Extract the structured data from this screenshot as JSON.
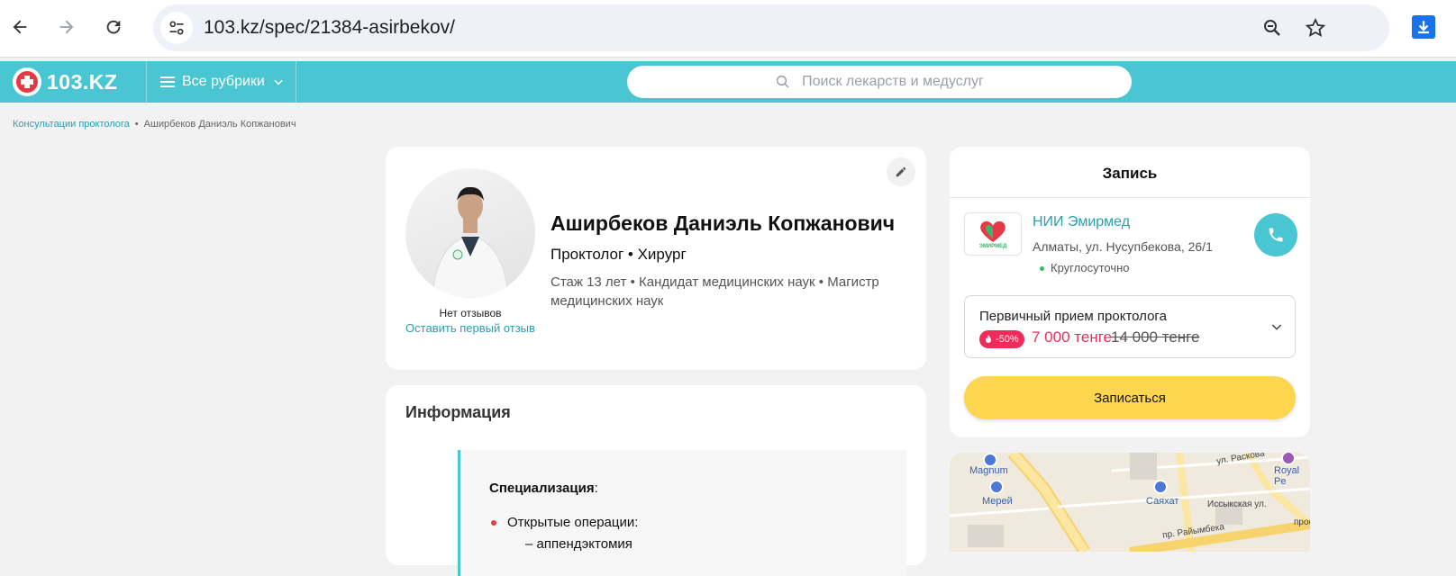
{
  "browser": {
    "url": "103.kz/spec/21384-asirbekov/",
    "icons": [
      "back-arrow-icon",
      "forward-arrow-icon",
      "reload-icon",
      "site-settings-icon",
      "zoom-icon",
      "bookmark-star-icon",
      "download-icon"
    ]
  },
  "header": {
    "logo_text": "103.KZ",
    "rubrics_label": "Все рубрики",
    "search_placeholder": "Поиск лекарств и медуслуг",
    "accent_color": "#4ac6d2"
  },
  "breadcrumbs": {
    "parent": "Консультации проктолога",
    "separator": "•",
    "current": "Аширбеков Даниэль Копжанович"
  },
  "profile": {
    "name": "Аширбеков Даниэль Копжанович",
    "specialties": "Проктолог • Хирург",
    "meta": "Стаж 13 лет  •  Кандидат медицинских наук • Магистр медицинских наук",
    "reviews_status": "Нет отзывов",
    "leave_review": "Оставить первый отзыв"
  },
  "info": {
    "title": "Информация",
    "spec_heading": "Специализация",
    "spec_colon": ":",
    "spec_item": "Открытые операции:",
    "spec_subitem": "– аппендэктомия"
  },
  "booking": {
    "title": "Запись",
    "clinic_name": "НИИ Эмирмед",
    "clinic_logo_text": "ЭМИРМЕД",
    "clinic_address": "Алматы, ул. Нусупбекова, 26/1",
    "clinic_hours": "Круглосуточно",
    "service_name": "Первичный прием проктолога",
    "discount": "-50%",
    "price_new": "7 000 тенге",
    "price_old": "14 000 тенге",
    "book_button": "Записаться",
    "button_color": "#fdd54f",
    "price_color": "#ee2c5b"
  },
  "map": {
    "labels": {
      "magnum": "Magnum",
      "merey": "Мерей",
      "sayakhat": "Саяхат",
      "royal": "Royal Pe",
      "street_raskova": "ул. Раскова",
      "street_issyk": "Иссыкская ул.",
      "street_raiymbek": "пр. Райымбека",
      "street_pros": "прос"
    }
  }
}
